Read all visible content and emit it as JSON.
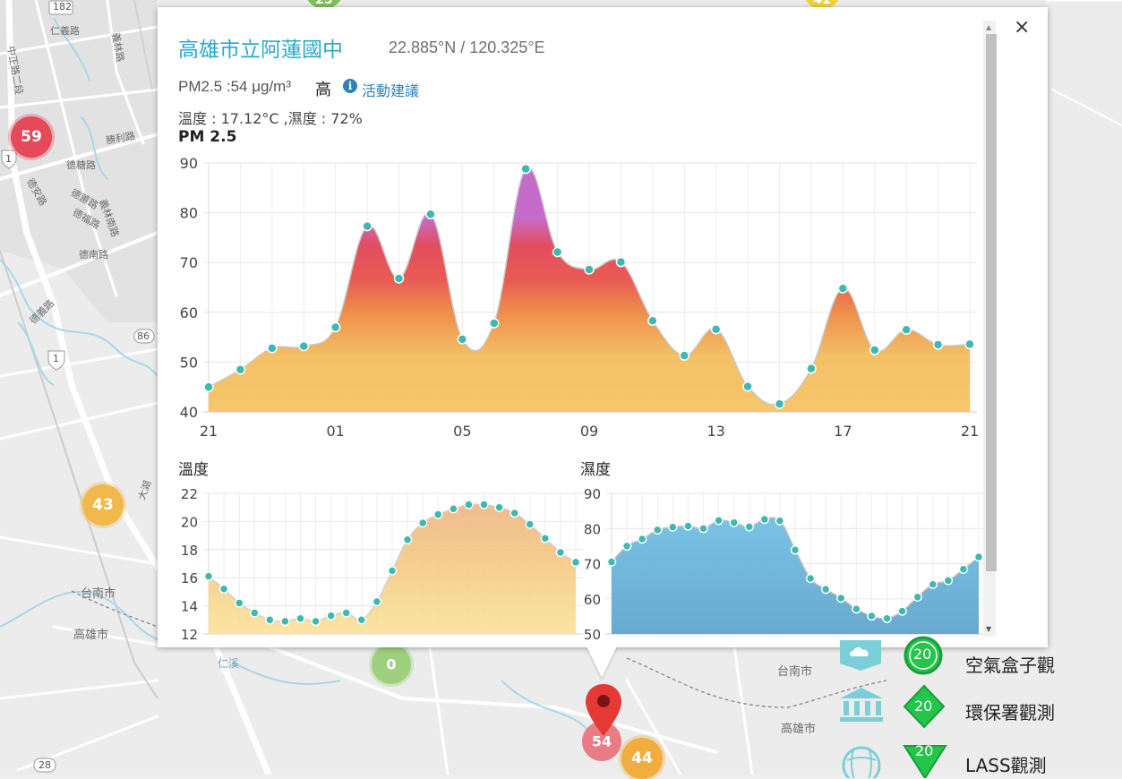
{
  "popup": {
    "title": "高雄市立阿蓮國中",
    "coords": "22.885°N / 120.325°E",
    "pm_line": "PM2.5 :54 μg/m³",
    "pm_level": "高",
    "advice_link": "活動建議",
    "env_line": "溫度 : 17.12°C ,濕度 : 72%",
    "close": "×",
    "info_icon": "i"
  },
  "map": {
    "road_numbers": [
      "182",
      "86",
      "1",
      "1",
      "28"
    ],
    "street_labels": [
      "仁義路",
      "中正路二段",
      "義林路",
      "勝利路",
      "德糖路",
      "德安路",
      "德福路",
      "德南路",
      "義林南路",
      "德蕙路",
      "德義路",
      "台南市",
      "高雄市",
      "台南市",
      "高雄市",
      "仁溪",
      "大湖"
    ],
    "clusters": [
      "59",
      "43",
      "0",
      "54",
      "44",
      "23",
      "41"
    ]
  },
  "legend": {
    "items": [
      {
        "label": "空氣盒子觀",
        "badge": "20",
        "icon": "cloud-box-icon"
      },
      {
        "label": "環保署觀測",
        "badge": "20",
        "icon": "government-building-icon"
      },
      {
        "label": "LASS觀測",
        "badge": "20",
        "icon": "globe-icon"
      }
    ]
  },
  "chart_data": [
    {
      "type": "area",
      "title": "PM 2.5",
      "x_tick_labels": [
        "21",
        "01",
        "05",
        "09",
        "13",
        "17",
        "21"
      ],
      "ylim": [
        40,
        90
      ],
      "y_ticks": [
        40,
        50,
        60,
        70,
        80,
        90
      ],
      "grid": true,
      "values": [
        45,
        48.5,
        52.8,
        53.2,
        57,
        77.3,
        66.8,
        79.7,
        54.6,
        57.8,
        88.8,
        72.1,
        68.6,
        70.1,
        58.3,
        51.3,
        56.6,
        45.1,
        41.6,
        48.7,
        64.8,
        52.4,
        56.5,
        53.5,
        53.6
      ],
      "color_stops": [
        "#f5c66a",
        "#ef8d4d",
        "#e5485a",
        "#c07ac9"
      ]
    },
    {
      "type": "area",
      "title": "溫度",
      "ylim": [
        12,
        22
      ],
      "y_ticks": [
        12,
        14,
        16,
        18,
        20,
        22
      ],
      "grid": true,
      "values": [
        16.1,
        15.2,
        14.2,
        13.5,
        13.0,
        12.9,
        13.1,
        12.9,
        13.3,
        13.5,
        13.0,
        14.3,
        16.5,
        18.7,
        19.9,
        20.5,
        20.9,
        21.2,
        21.2,
        21.0,
        20.6,
        19.8,
        18.8,
        17.8,
        17.1
      ],
      "fill_color": "#f2c58a"
    },
    {
      "type": "area",
      "title": "濕度",
      "ylim": [
        50,
        90
      ],
      "y_ticks": [
        50,
        60,
        70,
        80,
        90
      ],
      "grid": true,
      "values": [
        70.5,
        75,
        77,
        79.6,
        80.4,
        80.7,
        80.0,
        82.3,
        81.7,
        80.5,
        82.6,
        82.2,
        73.9,
        65.8,
        62.7,
        60.2,
        57.1,
        55.1,
        54.4,
        56.5,
        60.5,
        64.1,
        65.2,
        68.4,
        71.9
      ],
      "fill_color": "#74bde0"
    }
  ],
  "colors": {
    "accent_title": "#29a9c9",
    "marker": "#3eb8b0",
    "link": "#2d82b8"
  }
}
